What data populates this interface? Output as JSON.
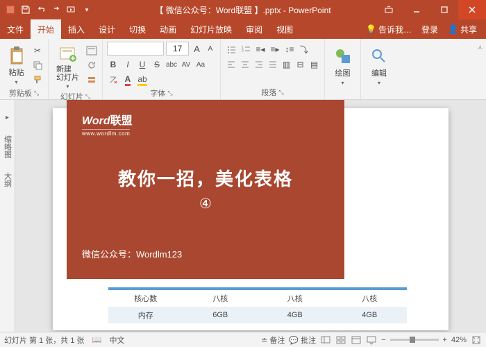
{
  "titlebar": {
    "title": "【 微信公众号：Word联盟 】.pptx - PowerPoint"
  },
  "menu": {
    "file": "文件",
    "tabs": [
      "开始",
      "插入",
      "设计",
      "切换",
      "动画",
      "幻灯片放映",
      "审阅",
      "视图"
    ],
    "active": 0,
    "tell_me": "告诉我…",
    "signin": "登录",
    "share": "共享"
  },
  "ribbon": {
    "clipboard": {
      "paste": "粘贴",
      "label": "剪贴板"
    },
    "slides": {
      "new": "新建\n幻灯片",
      "label": "幻灯片"
    },
    "font": {
      "size": "17",
      "label": "字体",
      "bold": "B",
      "italic": "I",
      "underline": "U",
      "strike": "S",
      "shadow": "abc",
      "spacing": "AV",
      "case": "Aa",
      "bigA": "A",
      "smA": "A"
    },
    "para": {
      "label": "段落"
    },
    "draw": {
      "label": "绘图"
    },
    "edit": {
      "label": "编辑"
    }
  },
  "outline": {
    "thumb": "缩略图",
    "outl": "大纲"
  },
  "slide": {
    "logo_main": "Word",
    "logo_cn": "联盟",
    "logo_url": "www.wordlm.com",
    "title": "教你一招，美化表格",
    "num": "④",
    "footer": "微信公众号：Wordlm123",
    "table": {
      "r1": [
        "核心数",
        "八核",
        "八核",
        "八核"
      ],
      "r2": [
        "内存",
        "6GB",
        "4GB",
        "4GB"
      ]
    }
  },
  "status": {
    "slide_info": "幻灯片 第 1 张，共 1 张",
    "lang": "中文",
    "notes": "备注",
    "comments": "批注",
    "zoom": "42%"
  }
}
